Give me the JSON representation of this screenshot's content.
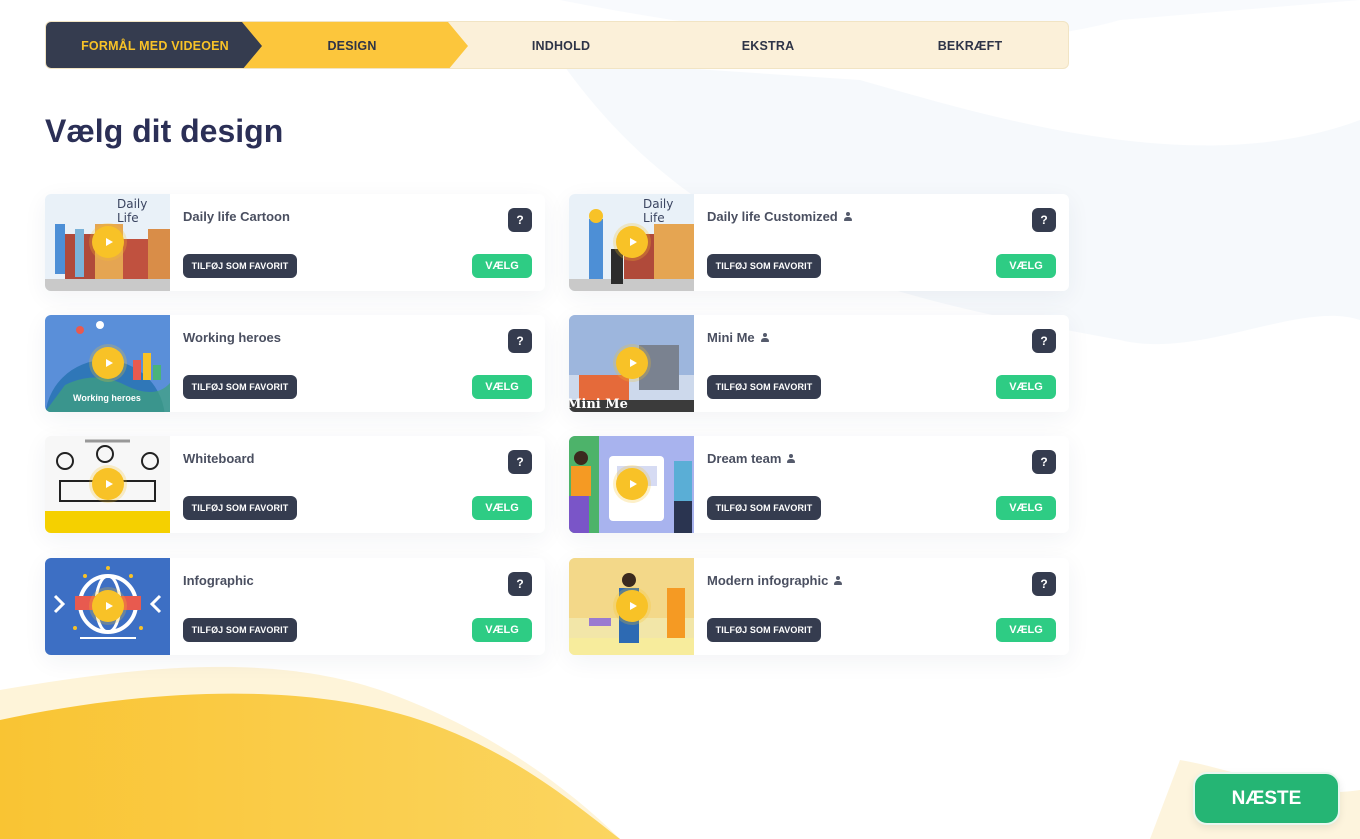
{
  "stepper": {
    "steps": [
      {
        "label": "FORMÅL MED VIDEOEN",
        "state": "completed"
      },
      {
        "label": "DESIGN",
        "state": "active"
      },
      {
        "label": "INDHOLD",
        "state": "pending"
      },
      {
        "label": "EKSTRA",
        "state": "pending"
      },
      {
        "label": "BEKRÆFT",
        "state": "pending"
      }
    ]
  },
  "page": {
    "title": "Vælg dit design"
  },
  "cards": [
    {
      "title": "Daily life Cartoon",
      "custom": false,
      "thumb_text": "Daily Life"
    },
    {
      "title": "Daily life Customized",
      "custom": true,
      "thumb_text": "Daily Life"
    },
    {
      "title": "Working heroes",
      "custom": false,
      "thumb_text": "Working heroes"
    },
    {
      "title": "Mini Me",
      "custom": true,
      "thumb_text": "Mini Me"
    },
    {
      "title": "Whiteboard",
      "custom": false,
      "thumb_text": ""
    },
    {
      "title": "Dream team",
      "custom": true,
      "thumb_text": ""
    },
    {
      "title": "Infographic",
      "custom": false,
      "thumb_text": ""
    },
    {
      "title": "Modern infographic",
      "custom": true,
      "thumb_text": ""
    }
  ],
  "buttons": {
    "help": "?",
    "favorite": "TILFØJ SOM FAVORIT",
    "choose": "VÆLG",
    "next": "NÆSTE"
  },
  "colors": {
    "dark": "#353c4f",
    "yellow": "#f8c227",
    "green": "#2ecc84",
    "step_bg": "#fbf0d9"
  }
}
